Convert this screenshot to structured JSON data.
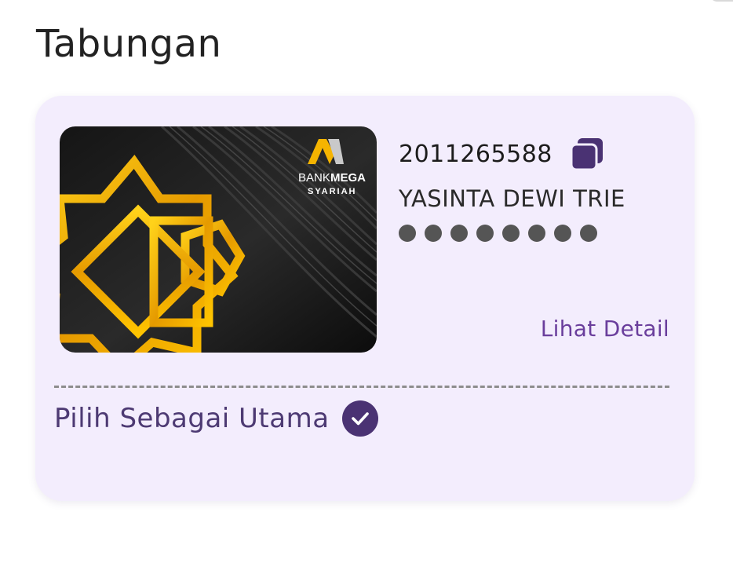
{
  "page": {
    "title": "Tabungan"
  },
  "account": {
    "number": "2011265588",
    "holder_name": "YASINTA DEWI TRIE",
    "masked_balance_dots": 8,
    "detail_link": "Lihat Detail",
    "primary_label": "Pilih Sebagai Utama",
    "is_primary": true
  },
  "card_image": {
    "brand_prefix": "BANK",
    "brand_name": "MEGA",
    "brand_sub": "SYARIAH"
  },
  "icons": {
    "copy": "copy-icon",
    "check": "check-circle-icon"
  },
  "colors": {
    "accent": "#4a3273",
    "link": "#6a3e9c",
    "card_background": "#f3edfd",
    "gold": "#e0a000"
  }
}
